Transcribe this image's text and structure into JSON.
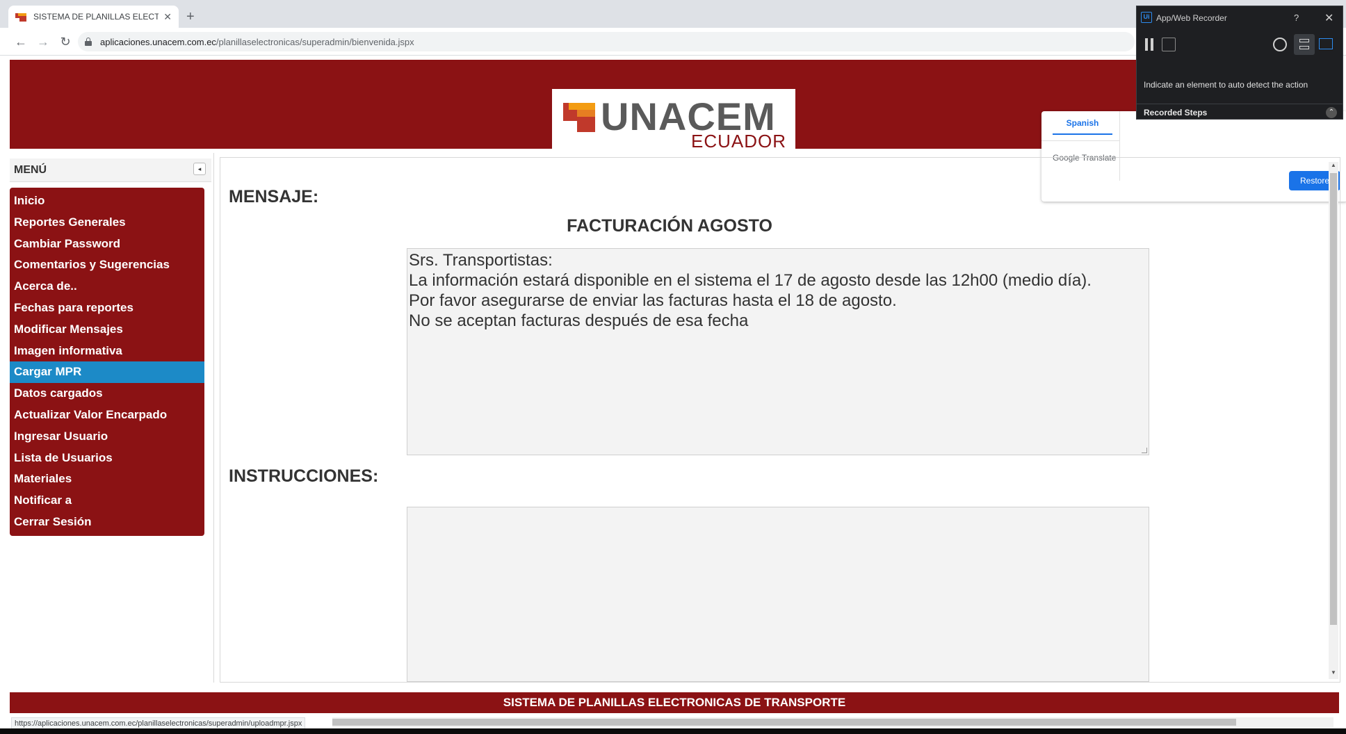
{
  "browser": {
    "tab_title": "SISTEMA DE PLANILLAS ELECTRO",
    "new_tab": "+",
    "close": "✕",
    "back": "←",
    "forward": "→",
    "reload": "↻",
    "url_host": "aplicaciones.unacem.com.ec",
    "url_path": "/planillaselectronicas/superadmin/bienvenida.jspx"
  },
  "banner": {
    "logo_text": "UNACEM",
    "logo_sub": "ECUADOR"
  },
  "translate": {
    "language": "Spanish",
    "brand": "Google Translate",
    "restore_label": "Restore"
  },
  "sidebar": {
    "title": "MENÚ",
    "collapse": "◂",
    "items": [
      {
        "label": "Inicio",
        "active": false
      },
      {
        "label": "Reportes Generales",
        "active": false
      },
      {
        "label": "Cambiar Password",
        "active": false
      },
      {
        "label": "Comentarios y Sugerencias",
        "active": false
      },
      {
        "label": "Acerca de..",
        "active": false
      },
      {
        "label": "Fechas para reportes",
        "active": false
      },
      {
        "label": "Modificar Mensajes",
        "active": false
      },
      {
        "label": "Imagen informativa",
        "active": false
      },
      {
        "label": "Cargar MPR",
        "active": true
      },
      {
        "label": "Datos cargados",
        "active": false
      },
      {
        "label": "Actualizar Valor Encarpado",
        "active": false
      },
      {
        "label": "Ingresar Usuario",
        "active": false
      },
      {
        "label": "Lista de Usuarios",
        "active": false
      },
      {
        "label": "Materiales",
        "active": false
      },
      {
        "label": "Notificar a",
        "active": false
      },
      {
        "label": "Cerrar Sesión",
        "active": false
      }
    ]
  },
  "content": {
    "mensaje_label": "MENSAJE:",
    "mensaje_heading": "FACTURACIÓN AGOSTO",
    "mensaje_lines": [
      "Srs. Transportistas:",
      "La información estará disponible en el sistema el 17 de agosto desde las 12h00 (medio día).",
      "Por favor asegurarse de enviar las facturas hasta el 18 de agosto.",
      "No se aceptan facturas después de esa fecha"
    ],
    "instrucciones_label": "INSTRUCCIONES:",
    "instrucciones_text": ""
  },
  "footer": {
    "title": "SISTEMA DE PLANILLAS ELECTRONICAS DE TRANSPORTE",
    "status_url": "https://aplicaciones.unacem.com.ec/planillaselectronicas/superadmin/uploadmpr.jspx"
  },
  "recorder": {
    "logo": "Ui",
    "title": "App/Web Recorder",
    "help": "?",
    "close": "✕",
    "hint": "Indicate an element to auto detect the action",
    "steps_label": "Recorded Steps",
    "steps_toggle": "⌃"
  },
  "colors": {
    "brand_red": "#8b1214",
    "active_blue": "#1c8ac7"
  }
}
